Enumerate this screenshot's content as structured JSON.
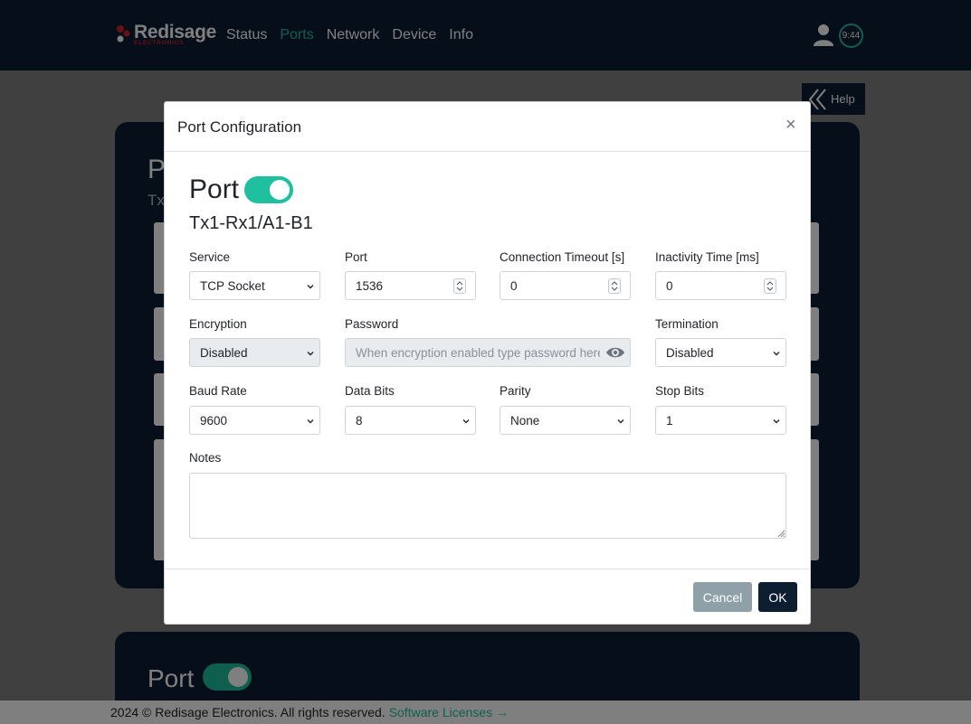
{
  "brand": {
    "name": "Redisage",
    "sub": "ELECTRONICS"
  },
  "nav": [
    {
      "label": "Status",
      "active": false
    },
    {
      "label": "Ports",
      "active": true
    },
    {
      "label": "Network",
      "active": false
    },
    {
      "label": "Device",
      "active": false
    },
    {
      "label": "Info",
      "active": false
    }
  ],
  "header": {
    "time": "9:44",
    "user_icon": "user-icon"
  },
  "help": {
    "label": "Help",
    "icon": "double-chevron-left-icon"
  },
  "background": {
    "card_title": "P",
    "card_subtitle": "Tx",
    "card2_title": "Port"
  },
  "footer": {
    "copyright": "2024 © Redisage Electronics. All rights reserved.",
    "link": "Software Licenses →"
  },
  "modal": {
    "title": "Port Configuration",
    "close": "×",
    "port_label": "Port",
    "port_enabled": true,
    "port_id": "Tx1-Rx1/A1-B1",
    "fields": {
      "service": {
        "label": "Service",
        "value": "TCP Socket"
      },
      "port": {
        "label": "Port",
        "value": "1536"
      },
      "connection_timeout": {
        "label": "Connection Timeout [s]",
        "value": "0"
      },
      "inactivity_time": {
        "label": "Inactivity Time [ms]",
        "value": "0"
      },
      "encryption": {
        "label": "Encryption",
        "value": "Disabled"
      },
      "password": {
        "label": "Password",
        "placeholder": "When encryption enabled type password here"
      },
      "termination": {
        "label": "Termination",
        "value": "Disabled"
      },
      "baud_rate": {
        "label": "Baud Rate",
        "value": "9600"
      },
      "data_bits": {
        "label": "Data Bits",
        "value": "8"
      },
      "parity": {
        "label": "Parity",
        "value": "None"
      },
      "stop_bits": {
        "label": "Stop Bits",
        "value": "1"
      },
      "notes": {
        "label": "Notes",
        "value": ""
      }
    },
    "cancel_label": "Cancel",
    "ok_label": "OK"
  },
  "colors": {
    "navy": "#0d1e33",
    "accent": "#1fbf9f",
    "cancel": "#8fa0a8",
    "brand_red": "#d0202f"
  }
}
